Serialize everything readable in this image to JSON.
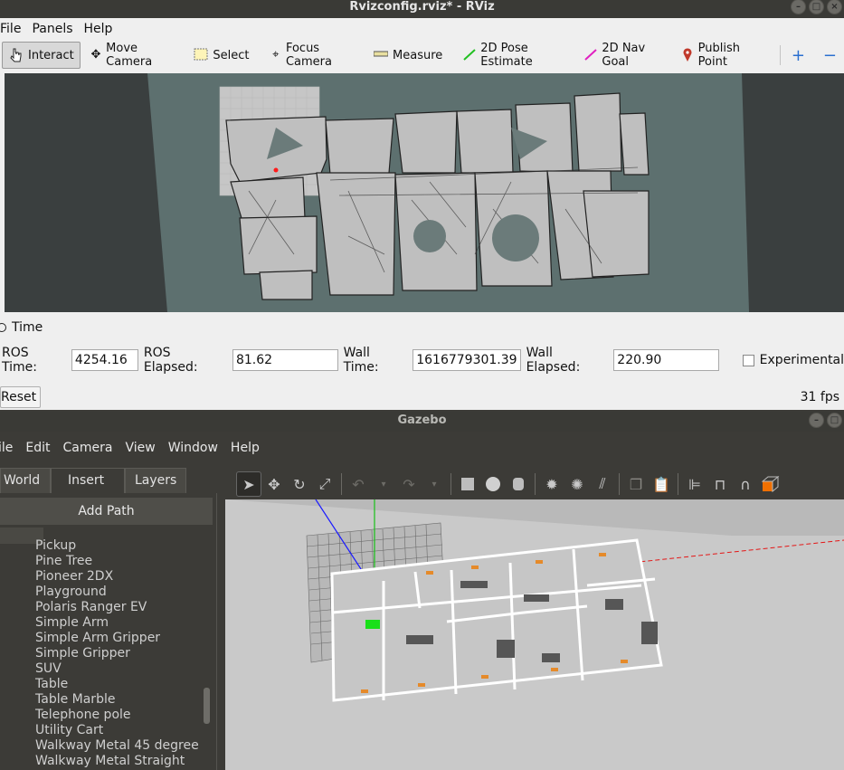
{
  "rviz": {
    "title": "Rvizconfig.rviz* - RViz",
    "menu": [
      "File",
      "Panels",
      "Help"
    ],
    "tools": [
      {
        "label": "Interact",
        "icon": "pointer-icon",
        "active": true
      },
      {
        "label": "Move Camera",
        "icon": "move-camera-icon"
      },
      {
        "label": "Select",
        "icon": "select-icon"
      },
      {
        "label": "Focus Camera",
        "icon": "focus-camera-icon"
      },
      {
        "label": "Measure",
        "icon": "measure-icon"
      },
      {
        "label": "2D Pose Estimate",
        "icon": "pose-estimate-arrow-icon",
        "color": "#22c022"
      },
      {
        "label": "2D Nav Goal",
        "icon": "nav-goal-arrow-icon",
        "color": "#e020c0"
      },
      {
        "label": "Publish Point",
        "icon": "map-pin-icon",
        "color": "#c0392b"
      }
    ],
    "time_panel": {
      "title": "Time",
      "ros_time_label": "ROS Time:",
      "ros_time": "4254.16",
      "ros_elapsed_label": "ROS Elapsed:",
      "ros_elapsed": "81.62",
      "wall_time_label": "Wall Time:",
      "wall_time": "1616779301.39",
      "wall_elapsed_label": "Wall Elapsed:",
      "wall_elapsed": "220.90",
      "experimental_label": "Experimental",
      "reset_label": "Reset",
      "fps": "31 fps"
    }
  },
  "gazebo": {
    "title": "Gazebo",
    "menu": [
      "ile",
      "Edit",
      "Camera",
      "View",
      "Window",
      "Help"
    ],
    "tabs": [
      "World",
      "Insert",
      "Layers"
    ],
    "active_tab": "Insert",
    "add_path_label": "Add Path",
    "models": [
      "Pickup",
      "Pine Tree",
      "Pioneer 2DX",
      "Playground",
      "Polaris Ranger EV",
      "Simple Arm",
      "Simple Arm Gripper",
      "Simple Gripper",
      "SUV",
      "Table",
      "Table Marble",
      "Telephone pole",
      "Utility Cart",
      "Walkway Metal 45 degree",
      "Walkway Metal Straight"
    ]
  }
}
